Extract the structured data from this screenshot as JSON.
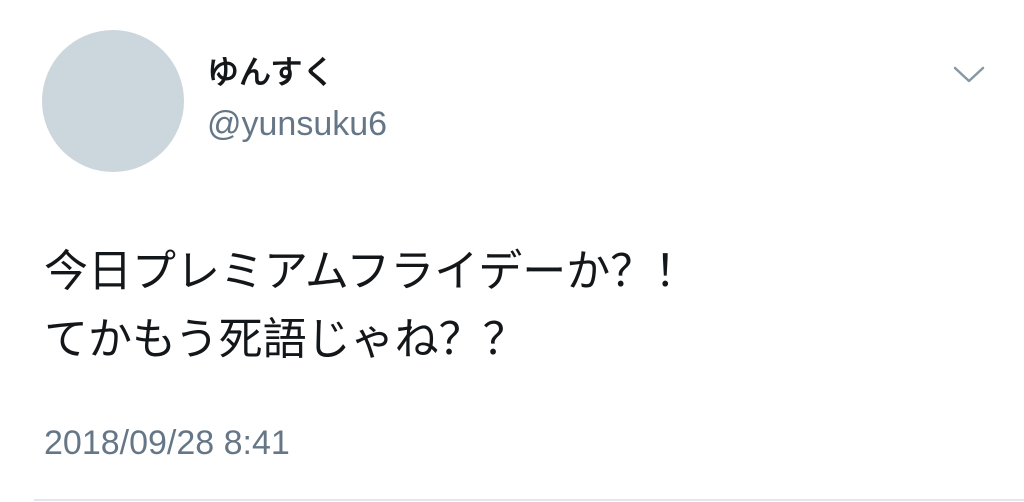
{
  "tweet": {
    "author": {
      "display_name": "ゆんすく",
      "handle": "@yunsuku6"
    },
    "text_lines": [
      "今日プレミアムフライデーか？！",
      "てかもう死語じゃね？？"
    ],
    "timestamp": "2018/09/28 8:41",
    "menu_icon": "chevron-down-icon"
  },
  "colors": {
    "avatar_placeholder": "#ccd6dd",
    "primary_text": "#14171a",
    "secondary_text": "#657786",
    "divider": "#e1e8ed"
  }
}
